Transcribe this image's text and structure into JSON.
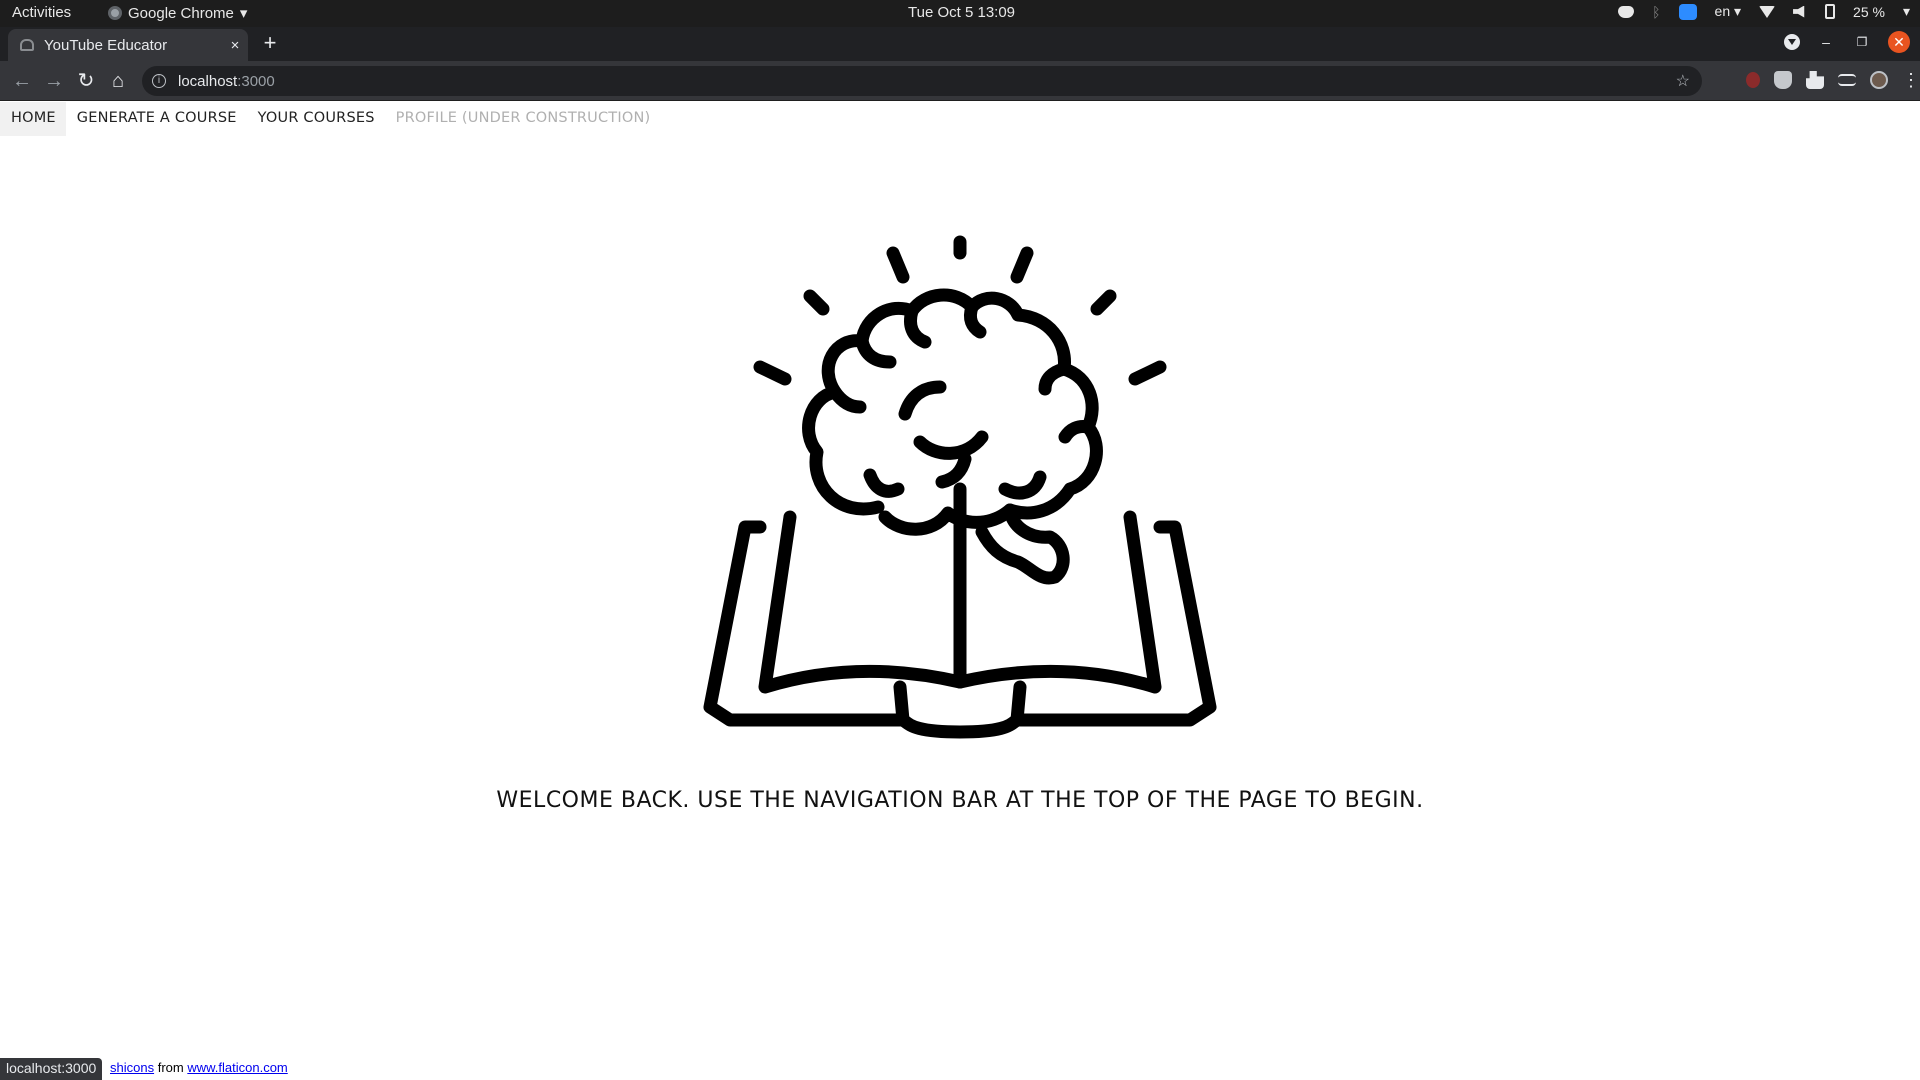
{
  "system_bar": {
    "activities": "Activities",
    "app_name": "Google Chrome",
    "clock": "Tue Oct 5  13:09",
    "language": "en",
    "battery": "25 %"
  },
  "browser": {
    "tab_title": "YouTube Educator",
    "tab_close": "×",
    "new_tab": "+",
    "url_host": "localhost",
    "url_port": ":3000",
    "status_url": "localhost:3000"
  },
  "nav": {
    "home": "HOME",
    "generate": "GENERATE A COURSE",
    "courses": "YOUR COURSES",
    "profile": "PROFILE (UNDER CONSTRUCTION)"
  },
  "main": {
    "hero_icon": "brain-book-icon",
    "welcome": "WELCOME BACK. USE THE NAVIGATION BAR AT THE TOP OF THE PAGE TO BEGIN."
  },
  "footer": {
    "icons_link": "shicons",
    "from": "from",
    "site_link": "www.flaticon.com"
  }
}
